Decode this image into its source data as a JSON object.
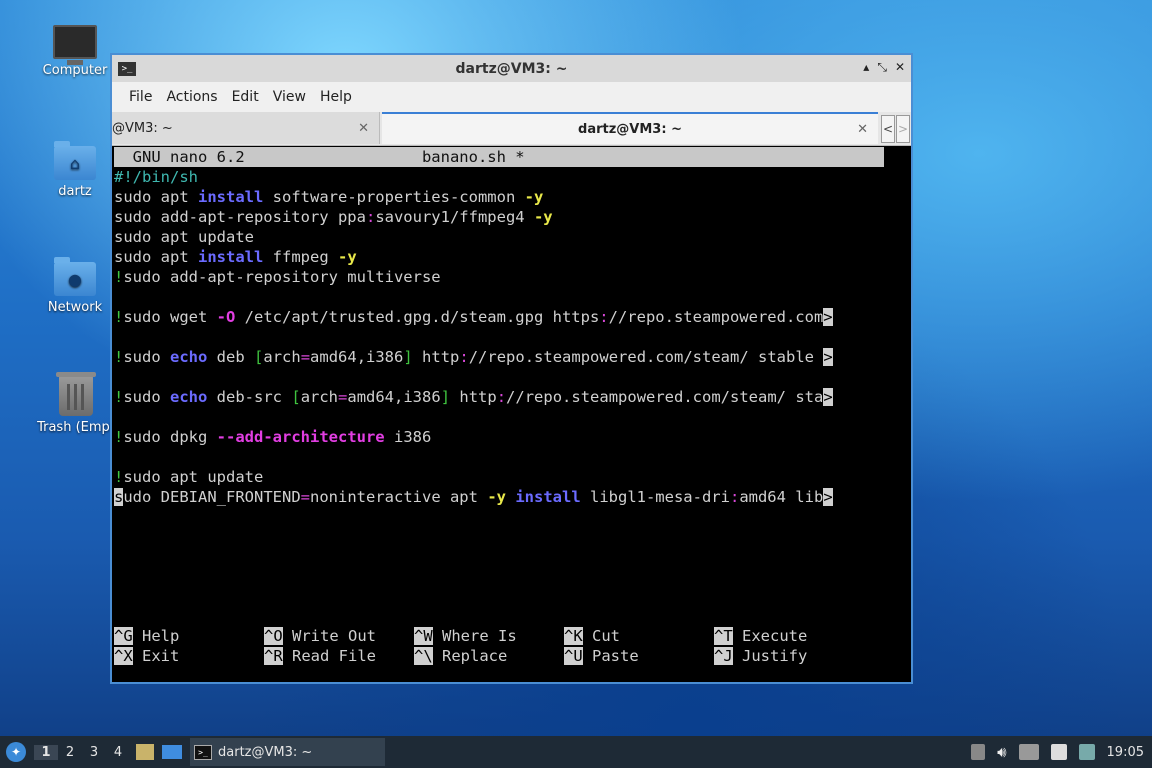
{
  "desktop": {
    "icons": [
      {
        "label": "Computer"
      },
      {
        "label": "dartz"
      },
      {
        "label": "Network"
      },
      {
        "label": "Trash (Empt"
      }
    ]
  },
  "window": {
    "title": "dartz@VM3: ~",
    "menu": [
      "File",
      "Actions",
      "Edit",
      "View",
      "Help"
    ],
    "tabs": [
      {
        "label": "@VM3: ~",
        "active": false
      },
      {
        "label": "dartz@VM3: ~",
        "active": true
      }
    ]
  },
  "nano": {
    "version": "GNU nano 6.2",
    "filename": "banano.sh *",
    "shortcuts": [
      {
        "key": "^G",
        "label": "Help"
      },
      {
        "key": "^X",
        "label": "Exit"
      },
      {
        "key": "^O",
        "label": "Write Out"
      },
      {
        "key": "^R",
        "label": "Read File"
      },
      {
        "key": "^W",
        "label": "Where Is"
      },
      {
        "key": "^\\",
        "label": "Replace"
      },
      {
        "key": "^K",
        "label": "Cut"
      },
      {
        "key": "^U",
        "label": "Paste"
      },
      {
        "key": "^T",
        "label": "Execute"
      },
      {
        "key": "^J",
        "label": "Justify"
      }
    ]
  },
  "taskbar": {
    "workspaces": [
      "1",
      "2",
      "3",
      "4"
    ],
    "task": "dartz@VM3: ~",
    "clock": "19:05"
  },
  "colors": {
    "accent": "#3a7fd5",
    "comment": "#3fc43f",
    "keyword": "#6b6bff",
    "flag": "#e8e84a",
    "option": "#e23ee2"
  }
}
